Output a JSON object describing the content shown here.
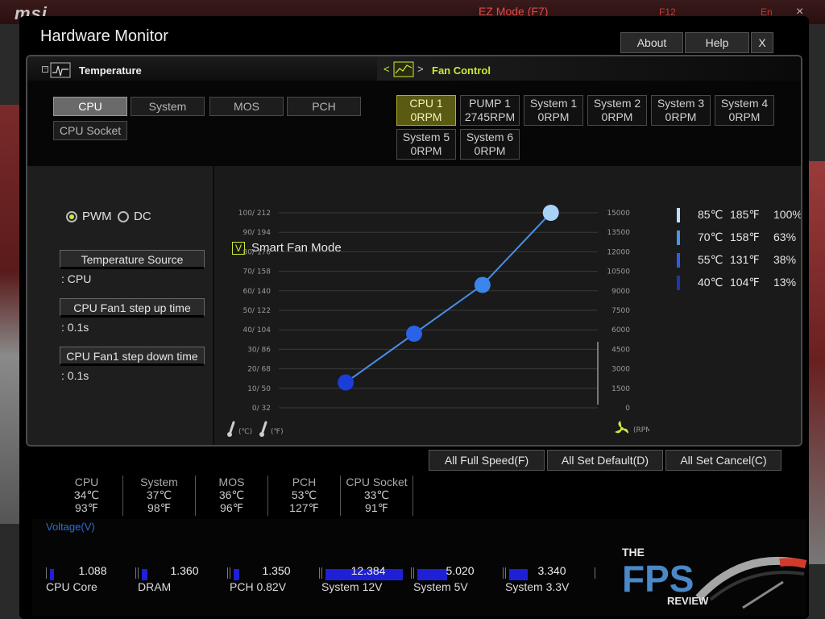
{
  "background": {
    "ez_mode": "EZ Mode (F7)",
    "f12": "F12",
    "lang": "En",
    "close": "×"
  },
  "window": {
    "title": "Hardware Monitor"
  },
  "top_buttons": {
    "about": "About",
    "help": "Help",
    "close": "X"
  },
  "temperature": {
    "header": "Temperature",
    "sources": [
      "CPU",
      "System",
      "MOS",
      "PCH",
      "CPU Socket"
    ],
    "selected": "CPU"
  },
  "fan_control": {
    "header": "Fan Control",
    "prev": "<",
    "next": ">",
    "fans": [
      {
        "name": "CPU 1",
        "rpm": "0RPM"
      },
      {
        "name": "PUMP 1",
        "rpm": "2745RPM"
      },
      {
        "name": "System 1",
        "rpm": "0RPM"
      },
      {
        "name": "System 2",
        "rpm": "0RPM"
      },
      {
        "name": "System 3",
        "rpm": "0RPM"
      },
      {
        "name": "System 4",
        "rpm": "0RPM"
      },
      {
        "name": "System 5",
        "rpm": "0RPM"
      },
      {
        "name": "System 6",
        "rpm": "0RPM"
      }
    ],
    "selected": "CPU 1"
  },
  "mode": {
    "pwm": "PWM",
    "dc": "DC",
    "selected": "PWM"
  },
  "settings": {
    "temp_source_label": "Temperature Source",
    "temp_source_value": ": CPU",
    "step_up_label": "CPU Fan1 step up time",
    "step_up_value": ": 0.1s",
    "step_down_label": "CPU Fan1 step down time",
    "step_down_value": ": 0.1s"
  },
  "smart_fan": {
    "label": "Smart Fan Mode",
    "checked": true,
    "check_mark": "V"
  },
  "chart_data": {
    "type": "line",
    "left_ticks": [
      "100/ 212",
      "90/ 194",
      "80/ 176",
      "70/ 158",
      "60/ 140",
      "50/ 122",
      "40/ 104",
      "30/  86",
      "20/  68",
      "10/  50",
      "0/  32"
    ],
    "right_ticks": [
      "15000",
      "13500",
      "12000",
      "10500",
      "9000",
      "7500",
      "6000",
      "4500",
      "3000",
      "1500",
      "0"
    ],
    "left_unit_c": "(℃)",
    "left_unit_f": "(℉)",
    "right_unit": "(RPM)",
    "ylim": [
      0,
      100
    ],
    "points": [
      {
        "temp_c": 40,
        "duty": 13,
        "color": "#1a3ed8"
      },
      {
        "temp_c": 55,
        "duty": 38,
        "color": "#2a62e8"
      },
      {
        "temp_c": 70,
        "duty": 63,
        "color": "#3a86ec"
      },
      {
        "temp_c": 85,
        "duty": 100,
        "color": "#a8d2f6"
      }
    ],
    "line_color": "#4a8fe8"
  },
  "legend": [
    {
      "c": "85℃",
      "f": "185℉",
      "pct": "100%",
      "color": "#c0def8"
    },
    {
      "c": "70℃",
      "f": "158℉",
      "pct": "63%",
      "color": "#4a94ec"
    },
    {
      "c": "55℃",
      "f": "131℉",
      "pct": "38%",
      "color": "#2a5ee8"
    },
    {
      "c": "40℃",
      "f": "104℉",
      "pct": "13%",
      "color": "#1a36b8"
    }
  ],
  "actions": {
    "full_speed": "All Full Speed(F)",
    "set_default": "All Set Default(D)",
    "set_cancel": "All Set Cancel(C)"
  },
  "temps": [
    {
      "name": "CPU",
      "c": "34℃",
      "f": "93℉"
    },
    {
      "name": "System",
      "c": "37℃",
      "f": "98℉"
    },
    {
      "name": "MOS",
      "c": "36℃",
      "f": "96℉"
    },
    {
      "name": "PCH",
      "c": "53℃",
      "f": "127℉"
    },
    {
      "name": "CPU Socket",
      "c": "33℃",
      "f": "91℉"
    }
  ],
  "voltage": {
    "title": "Voltage(V)",
    "items": [
      {
        "name": "CPU Core",
        "value": "1.088",
        "fill": 0.05
      },
      {
        "name": "DRAM",
        "value": "1.360",
        "fill": 0.07
      },
      {
        "name": "PCH 0.82V",
        "value": "1.350",
        "fill": 0.07
      },
      {
        "name": "System 12V",
        "value": "12.384",
        "fill": 0.92
      },
      {
        "name": "System 5V",
        "value": "5.020",
        "fill": 0.36
      },
      {
        "name": "System 3.3V",
        "value": "3.340",
        "fill": 0.22
      }
    ]
  },
  "watermark": {
    "the": "THE",
    "brand": "FPS",
    "review": "REVIEW"
  }
}
